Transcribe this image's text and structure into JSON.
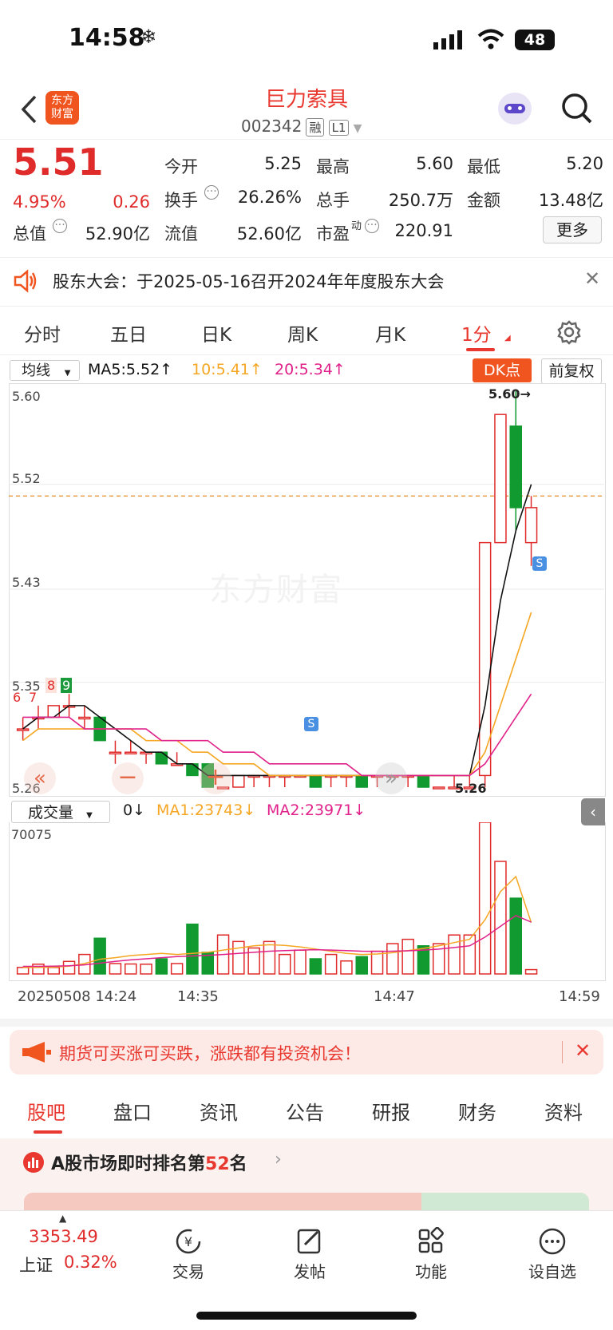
{
  "status_bar": {
    "time": "14:58",
    "battery": "48"
  },
  "header": {
    "title": "巨力索具",
    "code": "002342",
    "badge1": "融",
    "badge2": "L1"
  },
  "quote": {
    "price": "5.51",
    "change_pct": "4.95%",
    "change": "0.26",
    "open_label": "今开",
    "open": "5.25",
    "high_label": "最高",
    "high": "5.60",
    "low_label": "最低",
    "low": "5.20",
    "turnover_label": "换手",
    "turnover": "26.26%",
    "volume_label": "总手",
    "volume": "250.7万",
    "amount_label": "金额",
    "amount": "13.48亿",
    "mktcap_label": "总值",
    "mktcap": "52.90亿",
    "float_label": "流值",
    "float": "52.60亿",
    "pe_label": "市盈",
    "pe_sup": "动",
    "pe": "220.91",
    "more": "更多"
  },
  "notice": {
    "text": "股东大会：于2025-05-16召开2024年年度股东大会"
  },
  "chart_tabs": [
    "分时",
    "五日",
    "日K",
    "周K",
    "月K",
    "1分"
  ],
  "chart_toolbar": {
    "ma_select": "均线",
    "ma5": "MA5:5.52↑",
    "ma10": "10:5.41↑",
    "ma20": "20:5.34↑",
    "dk": "DK点",
    "adj": "前复权"
  },
  "vol_toolbar": {
    "select": "成交量",
    "v": "0↓",
    "ma1": "MA1:23743↓",
    "ma2": "MA2:23971↓"
  },
  "chart_labels": {
    "y": [
      "5.60",
      "5.52",
      "5.43",
      "5.35",
      "5.26"
    ],
    "max_marker": "5.60→",
    "min_marker": "5.26",
    "vol_max": "70075",
    "x": [
      "20250508 14:24",
      "14:35",
      "14:47",
      "14:59"
    ],
    "watermark": "东方财富",
    "sig_s": "S",
    "n6": "6",
    "n7": "7",
    "n8": "8",
    "n9": "9"
  },
  "chart_data": {
    "type": "candlestick",
    "ylim": [
      5.26,
      5.6
    ],
    "ref_line": 5.51,
    "candles": [
      {
        "o": 5.31,
        "c": 5.31,
        "h": 5.32,
        "l": 5.3
      },
      {
        "o": 5.32,
        "c": 5.32,
        "h": 5.33,
        "l": 5.31
      },
      {
        "o": 5.32,
        "c": 5.33,
        "h": 5.33,
        "l": 5.32
      },
      {
        "o": 5.33,
        "c": 5.33,
        "h": 5.34,
        "l": 5.32
      },
      {
        "o": 5.32,
        "c": 5.32,
        "h": 5.33,
        "l": 5.31
      },
      {
        "o": 5.32,
        "c": 5.3,
        "h": 5.32,
        "l": 5.3
      },
      {
        "o": 5.29,
        "c": 5.29,
        "h": 5.3,
        "l": 5.28
      },
      {
        "o": 5.29,
        "c": 5.29,
        "h": 5.3,
        "l": 5.29
      },
      {
        "o": 5.29,
        "c": 5.29,
        "h": 5.29,
        "l": 5.28
      },
      {
        "o": 5.29,
        "c": 5.28,
        "h": 5.29,
        "l": 5.28
      },
      {
        "o": 5.28,
        "c": 5.28,
        "h": 5.29,
        "l": 5.28
      },
      {
        "o": 5.28,
        "c": 5.27,
        "h": 5.28,
        "l": 5.27
      },
      {
        "o": 5.28,
        "c": 5.26,
        "h": 5.28,
        "l": 5.26
      },
      {
        "o": 5.26,
        "c": 5.26,
        "h": 5.26,
        "l": 5.26
      },
      {
        "o": 5.26,
        "c": 5.27,
        "h": 5.27,
        "l": 5.26
      },
      {
        "o": 5.27,
        "c": 5.27,
        "h": 5.27,
        "l": 5.26
      },
      {
        "o": 5.27,
        "c": 5.27,
        "h": 5.27,
        "l": 5.26
      },
      {
        "o": 5.27,
        "c": 5.27,
        "h": 5.27,
        "l": 5.26
      },
      {
        "o": 5.27,
        "c": 5.27,
        "h": 5.27,
        "l": 5.27
      },
      {
        "o": 5.27,
        "c": 5.26,
        "h": 5.27,
        "l": 5.26
      },
      {
        "o": 5.27,
        "c": 5.27,
        "h": 5.27,
        "l": 5.26
      },
      {
        "o": 5.27,
        "c": 5.27,
        "h": 5.27,
        "l": 5.26
      },
      {
        "o": 5.27,
        "c": 5.26,
        "h": 5.27,
        "l": 5.26
      },
      {
        "o": 5.27,
        "c": 5.27,
        "h": 5.27,
        "l": 5.26
      },
      {
        "o": 5.27,
        "c": 5.27,
        "h": 5.27,
        "l": 5.27
      },
      {
        "o": 5.27,
        "c": 5.27,
        "h": 5.27,
        "l": 5.26
      },
      {
        "o": 5.27,
        "c": 5.26,
        "h": 5.27,
        "l": 5.26
      },
      {
        "o": 5.26,
        "c": 5.26,
        "h": 5.26,
        "l": 5.26
      },
      {
        "o": 5.26,
        "c": 5.26,
        "h": 5.27,
        "l": 5.26
      },
      {
        "o": 5.26,
        "c": 5.26,
        "h": 5.27,
        "l": 5.26
      },
      {
        "o": 5.27,
        "c": 5.47,
        "h": 5.47,
        "l": 5.26
      },
      {
        "o": 5.47,
        "c": 5.58,
        "h": 5.58,
        "l": 5.47
      },
      {
        "o": 5.57,
        "c": 5.5,
        "h": 5.6,
        "l": 5.48
      },
      {
        "o": 5.47,
        "c": 5.5,
        "h": 5.51,
        "l": 5.45
      }
    ],
    "ma5": [
      5.31,
      5.32,
      5.32,
      5.33,
      5.33,
      5.32,
      5.31,
      5.3,
      5.29,
      5.29,
      5.28,
      5.28,
      5.27,
      5.27,
      5.27,
      5.27,
      5.27,
      5.27,
      5.27,
      5.27,
      5.27,
      5.27,
      5.27,
      5.27,
      5.27,
      5.27,
      5.27,
      5.27,
      5.27,
      5.27,
      5.33,
      5.42,
      5.48,
      5.52
    ],
    "ma10": [
      5.3,
      5.31,
      5.31,
      5.31,
      5.31,
      5.31,
      5.31,
      5.31,
      5.3,
      5.3,
      5.3,
      5.29,
      5.29,
      5.28,
      5.28,
      5.28,
      5.27,
      5.27,
      5.27,
      5.27,
      5.27,
      5.27,
      5.27,
      5.27,
      5.27,
      5.27,
      5.27,
      5.27,
      5.27,
      5.27,
      5.29,
      5.33,
      5.37,
      5.41
    ],
    "ma20": [
      5.32,
      5.32,
      5.32,
      5.32,
      5.31,
      5.31,
      5.31,
      5.31,
      5.31,
      5.3,
      5.3,
      5.3,
      5.3,
      5.29,
      5.29,
      5.29,
      5.28,
      5.28,
      5.28,
      5.28,
      5.28,
      5.28,
      5.27,
      5.27,
      5.27,
      5.27,
      5.27,
      5.27,
      5.27,
      5.27,
      5.28,
      5.3,
      5.32,
      5.34
    ],
    "volume": [
      3000,
      4500,
      3000,
      5800,
      9000,
      16500,
      4800,
      4600,
      4500,
      7000,
      4800,
      23000,
      10000,
      18000,
      15000,
      12000,
      15000,
      9000,
      11000,
      7000,
      9000,
      6000,
      8000,
      10500,
      14000,
      16000,
      13000,
      14000,
      18000,
      18000,
      70075,
      52000,
      35000,
      2000
    ],
    "vol_ma1": [
      3000,
      3000,
      3200,
      3600,
      4800,
      6800,
      7500,
      8500,
      9000,
      9500,
      9000,
      9500,
      10000,
      11000,
      12000,
      13000,
      13500,
      13200,
      12500,
      11500,
      10500,
      9500,
      9000,
      9200,
      9800,
      10800,
      11800,
      13000,
      14500,
      16000,
      25000,
      38000,
      45000,
      23743
    ],
    "vol_ma2": [
      3500,
      3500,
      3600,
      3800,
      4200,
      5000,
      5800,
      6500,
      7000,
      7500,
      8000,
      8300,
      8600,
      9000,
      9500,
      10000,
      10500,
      10800,
      11000,
      11200,
      11000,
      10800,
      10500,
      10400,
      10500,
      10700,
      11000,
      11500,
      12200,
      13000,
      17000,
      22000,
      27000,
      23971
    ]
  },
  "ad_banner": {
    "text": "期货可买涨可买跌，涨跌都有投资机会！"
  },
  "bottom_tabs": [
    "股吧",
    "盘口",
    "资讯",
    "公告",
    "研报",
    "财务",
    "资料"
  ],
  "rank": {
    "prefix": "A股市场即时排名第",
    "num": "52",
    "suffix": "名"
  },
  "bottom_bar": {
    "index_value": "3353.49",
    "index_name": "上证",
    "index_pct": "0.32%",
    "items": [
      "交易",
      "发帖",
      "功能",
      "设自选"
    ]
  },
  "colors": {
    "up": "#e02b2b",
    "down": "#119a2f",
    "accent": "#e8382f",
    "ma5": "#111111",
    "ma10": "#f5a623",
    "ma20": "#e0218a"
  }
}
